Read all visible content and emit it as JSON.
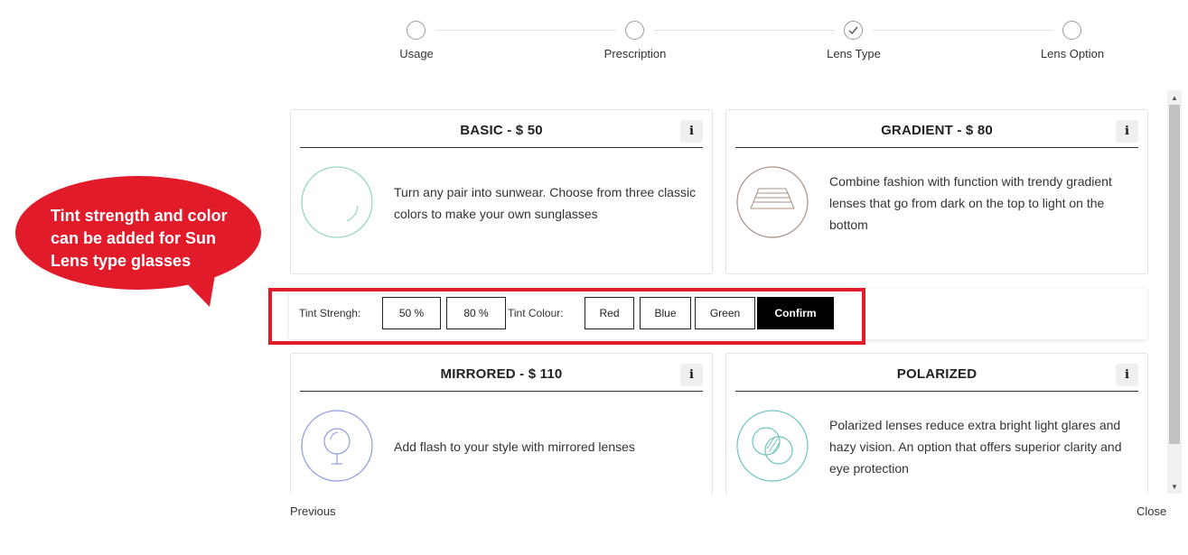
{
  "stepper": {
    "steps": [
      {
        "label": "Usage",
        "state": "pending"
      },
      {
        "label": "Prescription",
        "state": "pending"
      },
      {
        "label": "Lens Type",
        "state": "done"
      },
      {
        "label": "Lens Option",
        "state": "pending"
      }
    ]
  },
  "cards": [
    {
      "title": "BASIC - $ 50",
      "info_label": "i",
      "icon": "sun-lens-circle-icon",
      "description": "Turn any pair into sunwear. Choose from three classic colors to make your own sunglasses"
    },
    {
      "title": "GRADIENT - $ 80",
      "info_label": "i",
      "icon": "gradient-lens-icon",
      "description": "Combine fashion with function with trendy gradient lenses that go from dark on the top to light on the bottom"
    },
    {
      "title": "MIRRORED - $ 110",
      "info_label": "i",
      "icon": "mirror-icon",
      "description": "Add flash to your style with mirrored lenses"
    },
    {
      "title": "POLARIZED",
      "info_label": "i",
      "icon": "polarized-lens-icon",
      "description": "Polarized lenses reduce extra bright light glares and hazy vision. An option that offers superior clarity and eye protection"
    }
  ],
  "tint": {
    "strength_label": "Tint Strengh:",
    "strength_options": [
      "50 %",
      "80 %"
    ],
    "colour_label": "Tint Colour:",
    "colour_options": [
      "Red",
      "Blue",
      "Green"
    ],
    "confirm_label": "Confirm"
  },
  "callout": {
    "text": "Tint strength and color can be added for Sun Lens type glasses",
    "color": "#e21b2b"
  },
  "footer": {
    "previous_label": "Previous",
    "close_label": "Close"
  },
  "colors": {
    "highlight": "#e21b2b",
    "basic_icon": "#8fd6b8",
    "gradient_icon": "#a89086",
    "mirror_icon": "#8f9be0",
    "polarized_icon": "#6ec4c0"
  }
}
